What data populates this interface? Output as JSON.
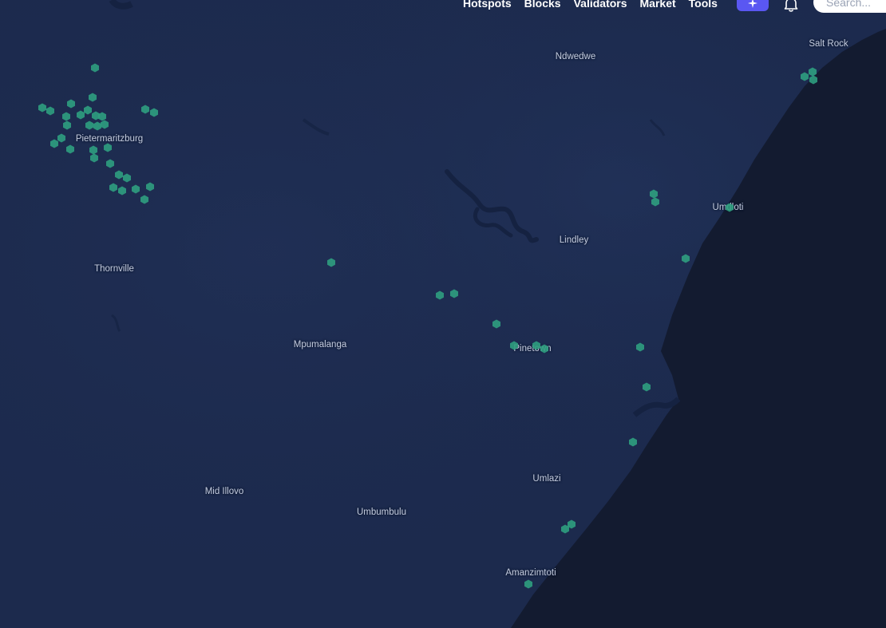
{
  "nav": {
    "links": [
      "Hotspots",
      "Blocks",
      "Validators",
      "Market",
      "Tools"
    ],
    "search_placeholder": "Search..."
  },
  "colors": {
    "land": "#1c2a4d",
    "ocean": "#131b30",
    "hotspot": "#2f9e7f",
    "accent": "#5a57f2"
  },
  "map": {
    "places": [
      "Salt Rock",
      "Ndwedwe",
      "Pietermaritzburg",
      "Umdloti",
      "Lindley",
      "Thornville",
      "Mpumalanga",
      "Pinetown",
      "Umlazi",
      "Mid Illovo",
      "Umbumbulu",
      "Amanzimtoti"
    ]
  }
}
